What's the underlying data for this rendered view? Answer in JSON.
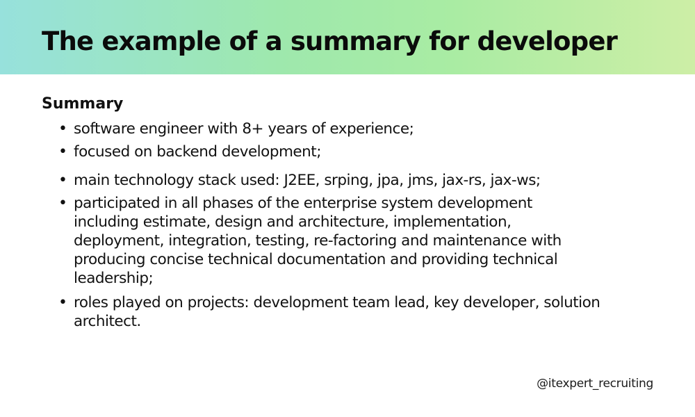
{
  "header": {
    "title": "The example of a summary for developer"
  },
  "summary": {
    "heading": "Summary",
    "items": [
      "software engineer with 8+ years of experience;",
      "focused on backend development;",
      "main technology stack used: J2EE, srping, jpa, jms, jax-rs, jax-ws;",
      "participated in all phases of the enterprise system development including estimate, design and architecture, implementation, deployment, integration, testing, re-factoring and maintenance with producing concise technical documentation and providing technical leadership;",
      "roles played on projects: development team lead, key developer, solution architect."
    ]
  },
  "footer": {
    "handle": "@itexpert_recruiting"
  },
  "colors": {
    "gradient_start": "#97e1dc",
    "gradient_mid": "#a9eca3",
    "gradient_end": "#cdeea6",
    "text": "#111111"
  }
}
